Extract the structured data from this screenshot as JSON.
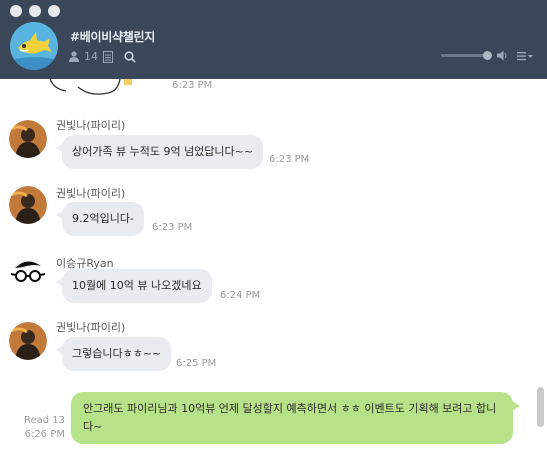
{
  "window": {
    "room_name": "#베이비샥챌린지",
    "member_count": "14"
  },
  "colors": {
    "header_bg": "#3a4759",
    "bubble_in": "#e8ebef",
    "bubble_out": "#b7e28a"
  },
  "messages": [
    {
      "time": "6:23 PM"
    },
    {
      "sender": "권빛나(파이리)",
      "text": "상어가족 뷰 누적도 9억 넘었답니다~~",
      "time": "6:23 PM"
    },
    {
      "sender": "권빛나(파이리)",
      "text": "9.2억입니다-",
      "time": "6:23 PM"
    },
    {
      "sender": "이승규Ryan",
      "text": "10월에 10억 뷰 나오겠네요",
      "time": "6:24 PM"
    },
    {
      "sender": "권빛나(파이리)",
      "text": "그렇습니다ㅎㅎ~~",
      "time": "6:25 PM"
    }
  ],
  "my_message": {
    "text": "안그래도 파이리님과 10억뷰 언제 달성할지 예측하면서 ㅎㅎ 이벤트도 기획해 보려고 합니다~",
    "read": "Read 13",
    "time": "6:26 PM"
  },
  "icons": [
    "person-icon",
    "document-icon",
    "search-icon",
    "speaker-icon",
    "menu-icon"
  ]
}
